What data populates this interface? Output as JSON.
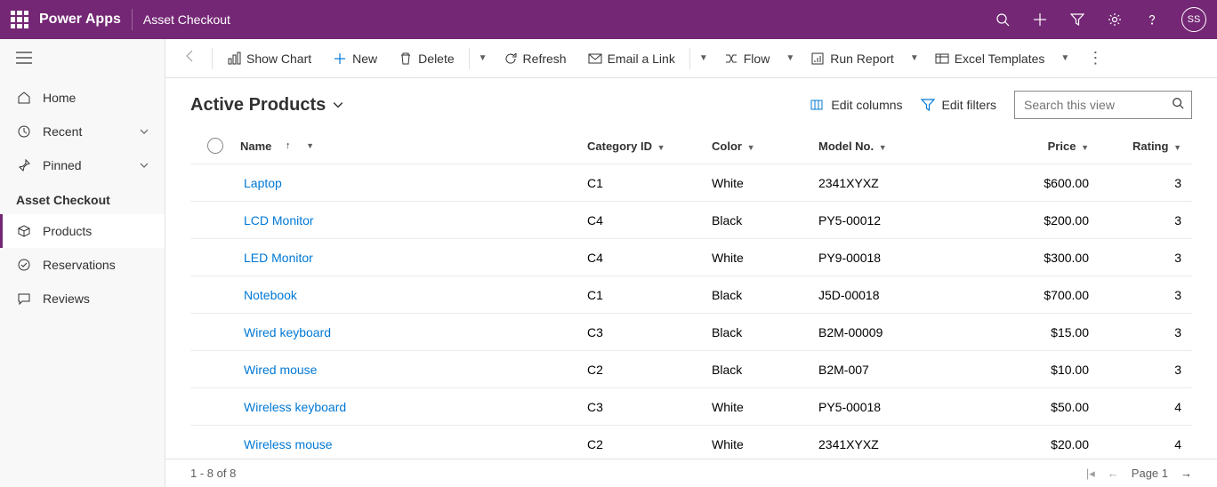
{
  "header": {
    "app_name": "Power Apps",
    "page_name": "Asset Checkout",
    "avatar_initials": "SS"
  },
  "sidebar": {
    "nav_home": "Home",
    "nav_recent": "Recent",
    "nav_pinned": "Pinned",
    "section_title": "Asset Checkout",
    "nav_products": "Products",
    "nav_reservations": "Reservations",
    "nav_reviews": "Reviews"
  },
  "commands": {
    "show_chart": "Show Chart",
    "new": "New",
    "delete": "Delete",
    "refresh": "Refresh",
    "email_link": "Email a Link",
    "flow": "Flow",
    "run_report": "Run Report",
    "excel_templates": "Excel Templates"
  },
  "view": {
    "title": "Active Products",
    "edit_columns": "Edit columns",
    "edit_filters": "Edit filters",
    "search_placeholder": "Search this view"
  },
  "columns": {
    "name": "Name",
    "category": "Category ID",
    "color": "Color",
    "model": "Model No.",
    "price": "Price",
    "rating": "Rating"
  },
  "rows": [
    {
      "name": "Laptop",
      "category": "C1",
      "color": "White",
      "model": "2341XYXZ",
      "price": "$600.00",
      "rating": "3"
    },
    {
      "name": "LCD Monitor",
      "category": "C4",
      "color": "Black",
      "model": "PY5-00012",
      "price": "$200.00",
      "rating": "3"
    },
    {
      "name": "LED Monitor",
      "category": "C4",
      "color": "White",
      "model": "PY9-00018",
      "price": "$300.00",
      "rating": "3"
    },
    {
      "name": "Notebook",
      "category": "C1",
      "color": "Black",
      "model": "J5D-00018",
      "price": "$700.00",
      "rating": "3"
    },
    {
      "name": "Wired keyboard",
      "category": "C3",
      "color": "Black",
      "model": "B2M-00009",
      "price": "$15.00",
      "rating": "3"
    },
    {
      "name": "Wired mouse",
      "category": "C2",
      "color": "Black",
      "model": "B2M-007",
      "price": "$10.00",
      "rating": "3"
    },
    {
      "name": "Wireless keyboard",
      "category": "C3",
      "color": "White",
      "model": "PY5-00018",
      "price": "$50.00",
      "rating": "4"
    },
    {
      "name": "Wireless mouse",
      "category": "C2",
      "color": "White",
      "model": "2341XYXZ",
      "price": "$20.00",
      "rating": "4"
    }
  ],
  "footer": {
    "count_text": "1 - 8 of 8",
    "page_label": "Page 1"
  }
}
